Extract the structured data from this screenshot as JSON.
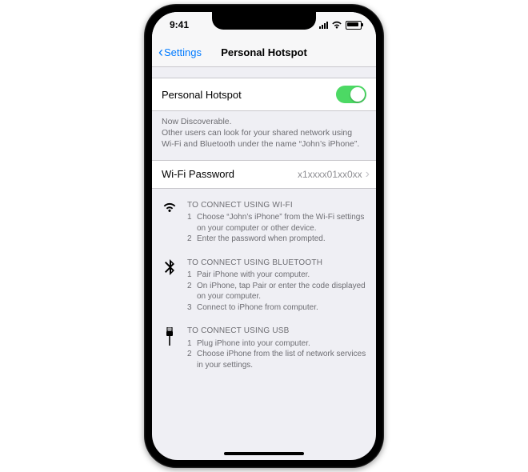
{
  "status": {
    "time": "9:41"
  },
  "nav": {
    "back_label": "Settings",
    "title": "Personal Hotspot"
  },
  "toggle": {
    "label": "Personal Hotspot",
    "on": true
  },
  "footer": {
    "line1": "Now Discoverable.",
    "line2": "Other users can look for your shared network using Wi-Fi and Bluetooth under the name “John’s iPhone”."
  },
  "password": {
    "label": "Wi-Fi Password",
    "value": "x1xxxx01xx0xx"
  },
  "instructions": {
    "wifi": {
      "title": "To connect using Wi-Fi",
      "steps": [
        "Choose “John’s iPhone” from the Wi-Fi settings on your computer or other device.",
        "Enter the password when prompted."
      ]
    },
    "bluetooth": {
      "title": "To connect using Bluetooth",
      "steps": [
        "Pair iPhone with your computer.",
        "On iPhone, tap Pair or enter the code displayed on your computer.",
        "Connect to iPhone from computer."
      ]
    },
    "usb": {
      "title": "To connect using USB",
      "steps": [
        "Plug iPhone into your computer.",
        "Choose iPhone from the list of network services in your settings."
      ]
    }
  }
}
